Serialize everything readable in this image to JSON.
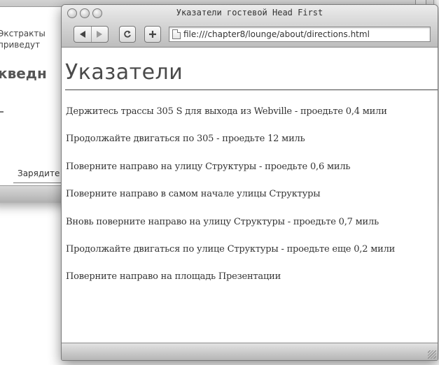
{
  "background_window": {
    "line1": "Экстракты",
    "line2": "приведут",
    "heading": "кведн",
    "bottom_label": "Зарядите"
  },
  "window": {
    "title": "Указатели гостевой Head First",
    "address": "file:///chapter8/lounge/about/directions.html",
    "reload_icon": "reload-icon",
    "add_icon": "plus-icon"
  },
  "page": {
    "title": "Указатели",
    "directions": [
      "Держитесь трассы 305 S для выхода из Webville - проедьте 0,4 мили",
      "Продолжайте двигаться по 305 - проедьте 12 миль",
      "Поверните направо на улицу Структуры - проедьте 0,6 миль",
      "Поверните направо в самом начале улицы Структуры",
      "Вновь поверните направо на улицу Структуры - проедьте 0,7 миль",
      "Продолжайте двигаться по улице Структуры - проедьте еще 0,2 мили",
      "Поверните направо на площадь Презентации"
    ]
  }
}
